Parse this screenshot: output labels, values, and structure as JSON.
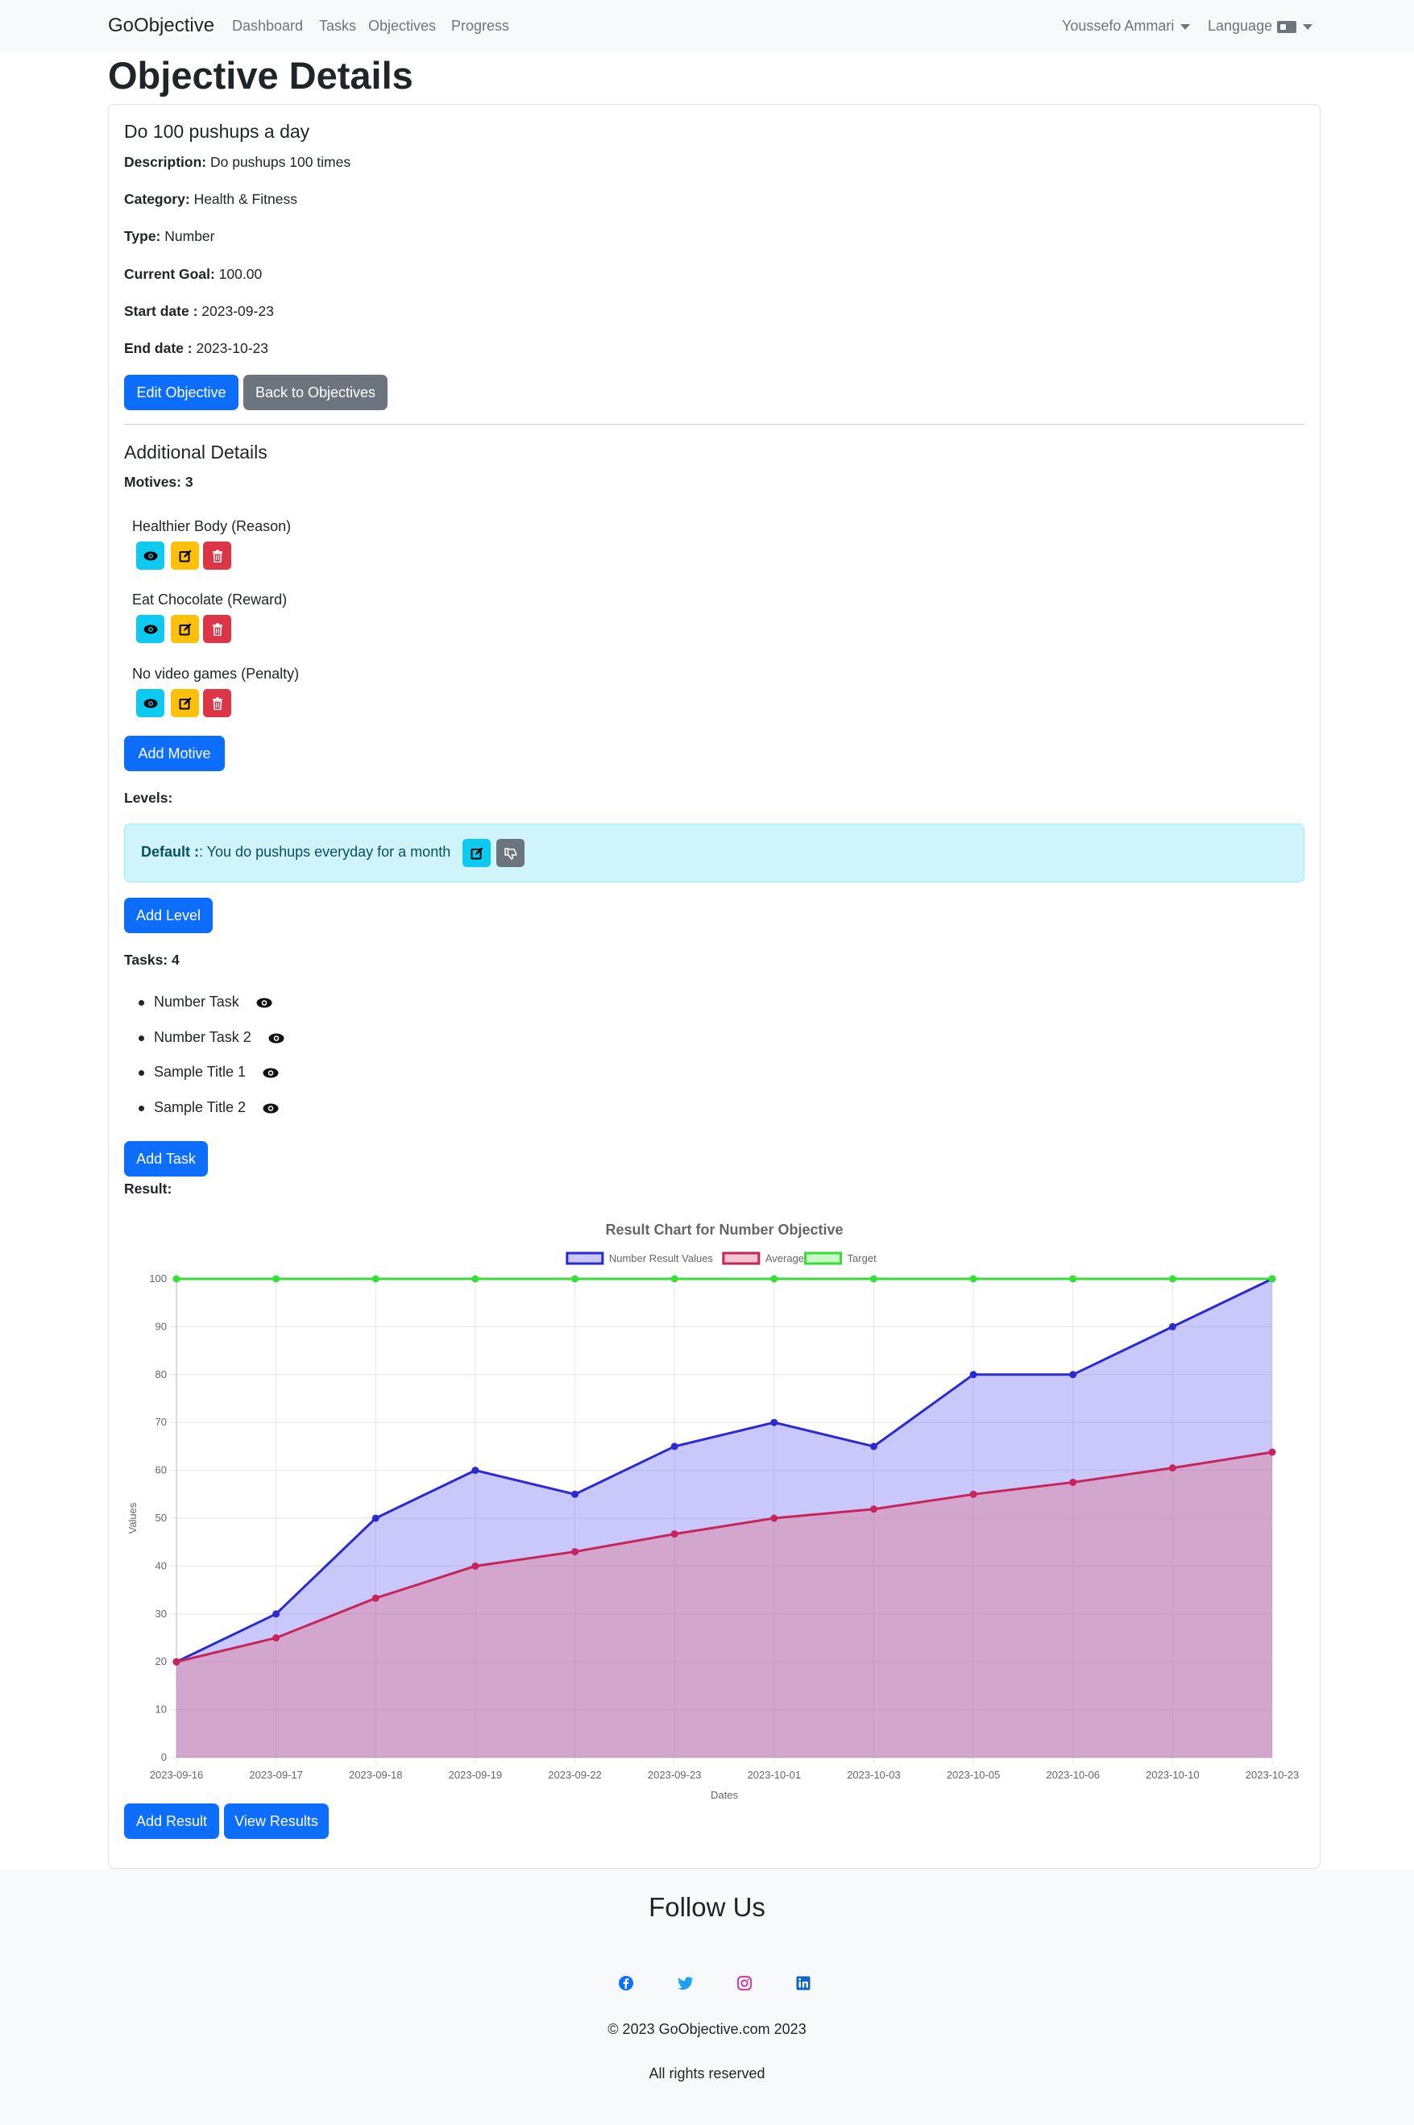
{
  "navbar": {
    "brand": "GoObjective",
    "links": [
      "Dashboard",
      "Tasks",
      "Objectives",
      "Progress"
    ],
    "user": "Youssefo Ammari",
    "language": "Language"
  },
  "page": {
    "title": "Objective Details"
  },
  "objective": {
    "name": "Do 100 pushups a day",
    "fields": [
      {
        "label": "Description:",
        "value": "Do pushups 100 times"
      },
      {
        "label": "Category:",
        "value": "Health & Fitness"
      },
      {
        "label": "Type:",
        "value": "Number"
      },
      {
        "label": "Current Goal:",
        "value": "100.00"
      },
      {
        "label": "Start date :",
        "value": "2023-09-23"
      },
      {
        "label": "End date :",
        "value": "2023-10-23"
      }
    ],
    "edit_label": "Edit Objective",
    "back_label": "Back to Objectives"
  },
  "additional": {
    "title": "Additional Details",
    "motives_label": "Motives: 3",
    "motives": [
      "Healthier Body (Reason)",
      "Eat Chocolate (Reward)",
      "No video games (Penalty)"
    ],
    "add_motive_label": "Add Motive",
    "levels_label": "Levels:",
    "level": {
      "name": "Default :",
      "text": ": You do pushups everyday for a month"
    },
    "add_level_label": "Add Level",
    "tasks_label": "Tasks: 4",
    "tasks": [
      "Number Task",
      "Number Task 2",
      "Sample Title 1",
      "Sample Title 2"
    ],
    "add_task_label": "Add Task",
    "result_label": "Result:",
    "add_result_label": "Add Result",
    "view_results_label": "View Results"
  },
  "colors": {
    "primary": "#0d6efd",
    "secondary": "#6c757d",
    "info": "#0dcaf0",
    "warning": "#ffc107",
    "danger": "#dc3545"
  },
  "chart_data": {
    "type": "line",
    "title": "Result Chart for Number Objective",
    "xlabel": "Dates",
    "ylabel": "Values",
    "ylim": [
      0,
      100
    ],
    "yticks": [
      0,
      10,
      20,
      30,
      40,
      50,
      60,
      70,
      80,
      90,
      100
    ],
    "categories": [
      "2023-09-16",
      "2023-09-17",
      "2023-09-18",
      "2023-09-19",
      "2023-09-22",
      "2023-09-23",
      "2023-10-01",
      "2023-10-03",
      "2023-10-05",
      "2023-10-06",
      "2023-10-10",
      "2023-10-23"
    ],
    "grid": true,
    "legend": "top-center",
    "series": [
      {
        "name": "Number Result Values",
        "values": [
          20,
          30,
          50,
          60,
          55,
          65,
          70,
          65,
          80,
          80,
          90,
          100
        ],
        "color": "#2a2ad4",
        "fill": "rgba(110,110,245,0.38)",
        "filled": true
      },
      {
        "name": "Average",
        "values": [
          20,
          25,
          33.3,
          40,
          43,
          46.7,
          50,
          51.9,
          55,
          57.5,
          60.5,
          63.8
        ],
        "color": "#c8245a",
        "fill": "rgba(225,120,140,0.42)",
        "filled": true
      },
      {
        "name": "Target",
        "values": [
          100,
          100,
          100,
          100,
          100,
          100,
          100,
          100,
          100,
          100,
          100,
          100
        ],
        "color": "#33e033",
        "fill": "rgba(120,240,120,0.4)",
        "filled": false
      }
    ]
  },
  "footer": {
    "title": "Follow Us",
    "social": [
      "facebook-icon",
      "twitter-icon",
      "instagram-icon",
      "linkedin-icon"
    ],
    "copyright": "© 2023 GoObjective.com 2023",
    "rights": "All rights reserved"
  }
}
